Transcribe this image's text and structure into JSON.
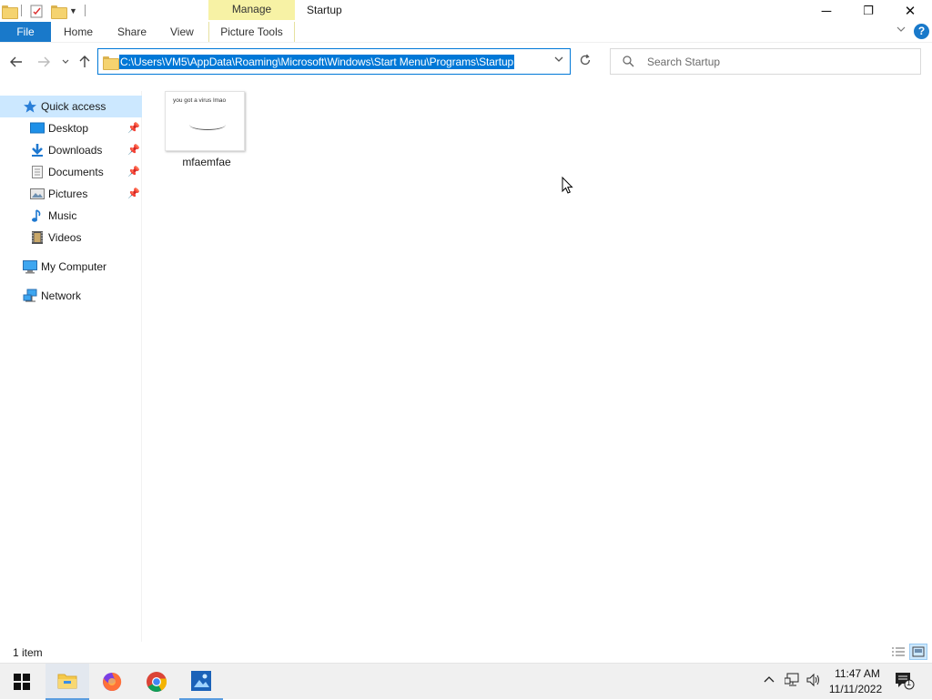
{
  "window": {
    "title": "Startup",
    "contextual_tab_group": "Manage",
    "controls": {
      "minimize": "─",
      "maximize": "❐",
      "close": "✕"
    }
  },
  "ribbon": {
    "tabs": [
      "File",
      "Home",
      "Share",
      "View",
      "Picture Tools"
    ],
    "help": "?"
  },
  "navigation": {
    "address": "C:\\Users\\VM5\\AppData\\Roaming\\Microsoft\\Windows\\Start Menu\\Programs\\Startup",
    "search_placeholder": "Search Startup"
  },
  "sidebar": {
    "quick_access": "Quick access",
    "items": [
      {
        "label": "Desktop",
        "pinned": true,
        "icon": "desktop-icon"
      },
      {
        "label": "Downloads",
        "pinned": true,
        "icon": "downloads-icon"
      },
      {
        "label": "Documents",
        "pinned": true,
        "icon": "documents-icon"
      },
      {
        "label": "Pictures",
        "pinned": true,
        "icon": "pictures-icon"
      },
      {
        "label": "Music",
        "pinned": false,
        "icon": "music-icon"
      },
      {
        "label": "Videos",
        "pinned": false,
        "icon": "videos-icon"
      }
    ],
    "my_computer": "My Computer",
    "network": "Network"
  },
  "content": {
    "files": [
      {
        "name": "mfaemfae",
        "thumbnail_text": "you got a virus lmao"
      }
    ]
  },
  "status": {
    "item_count": "1 item"
  },
  "taskbar": {
    "apps": [
      "file-explorer-icon",
      "firefox-icon",
      "chrome-icon",
      "photos-icon"
    ],
    "time": "11:47 AM",
    "date": "11/11/2022",
    "notifications": "1"
  },
  "colors": {
    "accent": "#0078d7",
    "file_tab": "#1979ca",
    "manage_tab": "#f7f2a5",
    "selection": "#cce8ff"
  }
}
